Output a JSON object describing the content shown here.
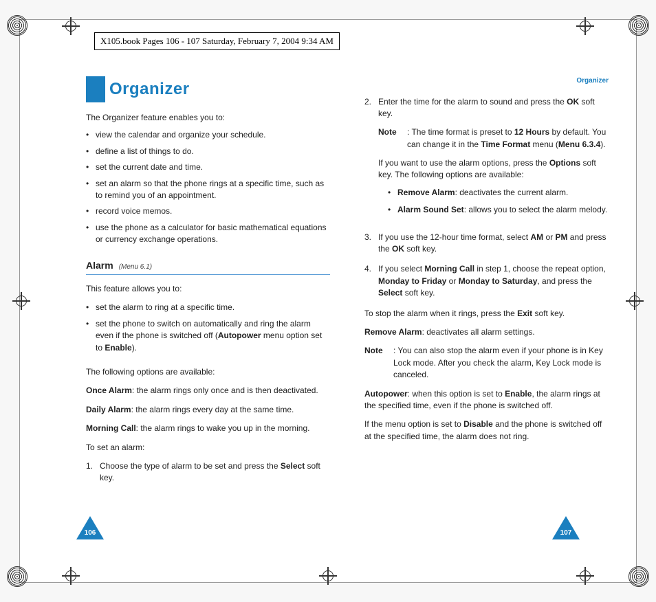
{
  "header": "X105.book  Pages 106 - 107  Saturday, February 7, 2004  9:34 AM",
  "chapter_title": "Organizer",
  "running_head": "Organizer",
  "intro": "The Organizer feature enables you to:",
  "features": [
    "view the calendar and organize your schedule.",
    "define a list of things to do.",
    "set the current date and time.",
    "set an alarm so that the phone rings at a specific time, such as to remind you of an appointment.",
    "record voice memos.",
    "use the phone as a calculator for basic mathematical equations or currency exchange operations."
  ],
  "section": {
    "title": "Alarm",
    "menu": "(Menu 6.1)"
  },
  "alarm_intro": "This feature allows you to:",
  "alarm_bullets": [
    {
      "text": "set the alarm to ring at a specific time."
    },
    {
      "prefix": "set the phone to switch on automatically and ring the alarm even if the phone is switched off (",
      "bold": "Autopower",
      "mid": " menu option set to ",
      "bold2": "Enable",
      "suffix": ")."
    }
  ],
  "options_intro": "The following options are available:",
  "options": [
    {
      "label": "Once Alarm",
      "desc": ": the alarm rings only once and is then deactivated."
    },
    {
      "label": "Daily Alarm",
      "desc": ": the alarm rings every day at the same time."
    },
    {
      "label": "Morning Call",
      "desc": ": the alarm rings to wake you up in the morning."
    }
  ],
  "set_intro": "To set an alarm:",
  "step1": {
    "num": "1.",
    "pre": "Choose the type of alarm to be set and press the ",
    "bold": "Select",
    "post": " soft key."
  },
  "step2": {
    "num": "2.",
    "pre": "Enter the time for the alarm to sound and press the ",
    "bold": "OK",
    "post": " soft key."
  },
  "note1": {
    "label": "Note",
    "pre": ": The time format is preset to ",
    "b1": "12 Hours",
    "mid1": " by default. You can change it in the ",
    "b2": "Time Format",
    "mid2": " menu (",
    "b3": "Menu 6.3.4",
    "post": ")."
  },
  "opt_press": {
    "pre": "If you want to use the alarm options, press the ",
    "bold": "Options",
    "post": " soft key. The following options are available:"
  },
  "sub_options": [
    {
      "label": "Remove Alarm",
      "desc": ": deactivates the current alarm."
    },
    {
      "label": "Alarm Sound Set",
      "desc": ": allows you to select the alarm melody."
    }
  ],
  "step3": {
    "num": "3.",
    "pre": "If you use the 12-hour time format, select ",
    "b1": "AM",
    "mid1": " or ",
    "b2": "PM",
    "mid2": " and press the ",
    "b3": "OK",
    "post": " soft key."
  },
  "step4": {
    "num": "4.",
    "pre": "If you select ",
    "b1": "Morning Call",
    "mid1": " in step 1, choose the repeat option, ",
    "b2": "Monday to Friday",
    "mid2": " or ",
    "b3": "Monday to Saturday",
    "mid3": ", and press the ",
    "b4": "Select",
    "post": " soft key."
  },
  "stop": {
    "pre": "To stop the alarm when it rings, press the ",
    "bold": "Exit",
    "post": " soft key."
  },
  "remove": {
    "label": "Remove Alarm",
    "desc": ": deactivates all alarm settings."
  },
  "note2": {
    "label": "Note",
    "body": ": You can also stop the alarm even if your phone is in Key Lock mode. After you check the alarm, Key Lock mode is canceled."
  },
  "autopower": {
    "label": "Autopower",
    "pre": ": when this option is set to ",
    "bold": "Enable",
    "post": ", the alarm rings at the specified time, even if the phone is switched off."
  },
  "disable": {
    "pre": "If the menu option is set to ",
    "bold": "Disable",
    "post": " and the phone is switched off at the specified time, the alarm does not ring."
  },
  "page_left": "106",
  "page_right": "107"
}
